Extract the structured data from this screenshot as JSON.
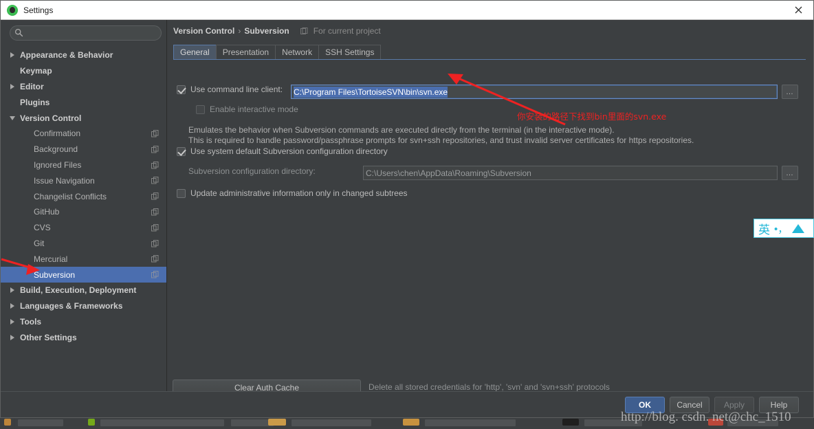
{
  "window": {
    "title": "Settings",
    "app_icon": "intellij-idea-icon",
    "close_label": "×"
  },
  "search": {
    "placeholder": "",
    "value": "",
    "icon": "search-icon"
  },
  "sidebar": {
    "items": [
      {
        "label": "Appearance & Behavior",
        "level": 0,
        "arrow": "right",
        "bold": true,
        "copy": false,
        "selected": false
      },
      {
        "label": "Keymap",
        "level": 0,
        "arrow": "none",
        "bold": true,
        "copy": false,
        "selected": false
      },
      {
        "label": "Editor",
        "level": 0,
        "arrow": "right",
        "bold": true,
        "copy": false,
        "selected": false
      },
      {
        "label": "Plugins",
        "level": 0,
        "arrow": "none",
        "bold": true,
        "copy": false,
        "selected": false
      },
      {
        "label": "Version Control",
        "level": 0,
        "arrow": "down",
        "bold": true,
        "copy": false,
        "selected": false
      },
      {
        "label": "Confirmation",
        "level": 1,
        "arrow": "none",
        "bold": false,
        "copy": true,
        "selected": false
      },
      {
        "label": "Background",
        "level": 1,
        "arrow": "none",
        "bold": false,
        "copy": true,
        "selected": false
      },
      {
        "label": "Ignored Files",
        "level": 1,
        "arrow": "none",
        "bold": false,
        "copy": true,
        "selected": false
      },
      {
        "label": "Issue Navigation",
        "level": 1,
        "arrow": "none",
        "bold": false,
        "copy": true,
        "selected": false
      },
      {
        "label": "Changelist Conflicts",
        "level": 1,
        "arrow": "none",
        "bold": false,
        "copy": true,
        "selected": false
      },
      {
        "label": "GitHub",
        "level": 1,
        "arrow": "none",
        "bold": false,
        "copy": true,
        "selected": false
      },
      {
        "label": "CVS",
        "level": 1,
        "arrow": "none",
        "bold": false,
        "copy": true,
        "selected": false
      },
      {
        "label": "Git",
        "level": 1,
        "arrow": "none",
        "bold": false,
        "copy": true,
        "selected": false
      },
      {
        "label": "Mercurial",
        "level": 1,
        "arrow": "none",
        "bold": false,
        "copy": true,
        "selected": false
      },
      {
        "label": "Subversion",
        "level": 1,
        "arrow": "none",
        "bold": false,
        "copy": true,
        "selected": true
      },
      {
        "label": "Build, Execution, Deployment",
        "level": 0,
        "arrow": "right",
        "bold": true,
        "copy": false,
        "selected": false
      },
      {
        "label": "Languages & Frameworks",
        "level": 0,
        "arrow": "right",
        "bold": true,
        "copy": false,
        "selected": false
      },
      {
        "label": "Tools",
        "level": 0,
        "arrow": "right",
        "bold": true,
        "copy": false,
        "selected": false
      },
      {
        "label": "Other Settings",
        "level": 0,
        "arrow": "right",
        "bold": true,
        "copy": false,
        "selected": false
      }
    ]
  },
  "breadcrumb": {
    "parent": "Version Control",
    "separator": "›",
    "current": "Subversion",
    "scope_icon": "project-scope-icon",
    "scope_note": "For current project"
  },
  "tabs": [
    {
      "label": "General",
      "active": true
    },
    {
      "label": "Presentation",
      "active": false
    },
    {
      "label": "Network",
      "active": false
    },
    {
      "label": "SSH Settings",
      "active": false
    }
  ],
  "form": {
    "use_command_line_client": {
      "label_pre": "",
      "label_mnemonic": "U",
      "label_post": "se command line client:",
      "label_full": "Use command line client:",
      "checked": true,
      "path_value": "C:\\Program Files\\TortoiseSVN\\bin\\svn.exe",
      "browse_label": "…"
    },
    "enable_interactive_mode": {
      "label": "Enable interactive mode",
      "checked": false,
      "disabled": true
    },
    "help_line_1": "Emulates the behavior when Subversion commands are executed directly from the terminal (in the interactive mode).",
    "help_line_2": "This is required to handle password/passphrase prompts for svn+ssh repositories, and trust invalid server certificates for https repositories.",
    "use_system_default_config_dir": {
      "label": "Use system default Subversion configuration directory",
      "checked": true
    },
    "config_directory": {
      "label": "Subversion configuration directory:",
      "value": "C:\\Users\\chen\\AppData\\Roaming\\Subversion",
      "browse_label": "…"
    },
    "update_admin_info": {
      "label": "Update administrative information only in changed subtrees",
      "checked": false
    },
    "clear_auth_cache": {
      "button_label": "Clear Auth Cache",
      "description": "Delete all stored credentials for 'http', 'svn' and 'svn+ssh' protocols"
    }
  },
  "footer": {
    "ok": "OK",
    "cancel": "Cancel",
    "apply": "Apply",
    "help": "Help"
  },
  "annotations": {
    "chinese_note": "你安装的路径下找到bin里面的svn.exe",
    "arrow_color": "#ee2222",
    "arrow_to_path_field": "arrow-pointing-to-path-field",
    "arrow_to_subversion_item": "arrow-pointing-to-subversion-item"
  },
  "watermark": {
    "text": "http://blog. csdn. net@chc_1510"
  },
  "ime": {
    "mode": "英",
    "punctuation": "•，",
    "tray_icon": "ime-triangle-icon"
  },
  "colors": {
    "accent_selection": "#4b6eaf",
    "dialog_bg": "#3c3f41",
    "field_bg": "#45494a",
    "annotation_red": "#ee2222",
    "ime_cyan": "#25b8d8"
  }
}
